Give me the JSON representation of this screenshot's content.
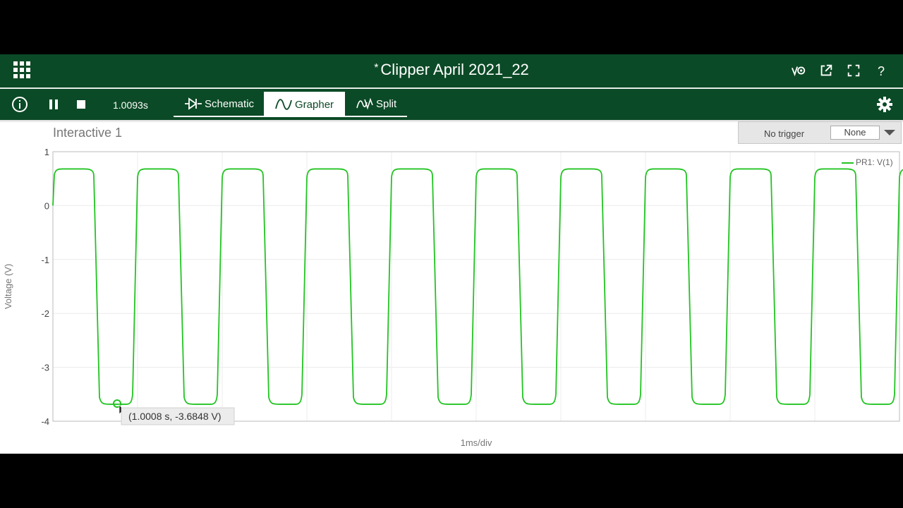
{
  "window": {
    "title": "Clipper April 2021_22",
    "dirty_marker": "*"
  },
  "toolbar": {
    "time_readout": "1.0093s",
    "tabs": [
      {
        "label": "Schematic",
        "active": false
      },
      {
        "label": "Grapher",
        "active": true
      },
      {
        "label": "Split",
        "active": false
      }
    ],
    "help_label": "?"
  },
  "graph": {
    "title": "Interactive 1",
    "trigger_label": "No trigger",
    "trigger_value": "None",
    "tooltip": "(1.0008 s, -3.6848 V)"
  },
  "colors": {
    "header_bg": "#0b4a26",
    "trace": "#22c422"
  },
  "icons": [
    "apps-grid-icon",
    "probe-icon",
    "external-link-icon",
    "fullscreen-icon",
    "help-icon",
    "info-icon",
    "pause-icon",
    "stop-icon",
    "diode-icon",
    "sine-icon",
    "split-icon",
    "gear-icon"
  ],
  "chart_data": {
    "type": "line",
    "xlabel": "1ms/div",
    "ylabel": "Voltage (V)",
    "ylim": [
      -4,
      1
    ],
    "yticks": [
      "1",
      "0",
      "-1",
      "-2",
      "-3",
      "-4"
    ],
    "x_divisions": 10,
    "grid": true,
    "legend_position": "top-right",
    "series": [
      {
        "name": "PR1: V(1)",
        "description_values": {
          "high_level_V": 0.68,
          "low_level_V": -3.685,
          "period_div": 1.0,
          "cycles_visible": 10
        }
      }
    ]
  }
}
